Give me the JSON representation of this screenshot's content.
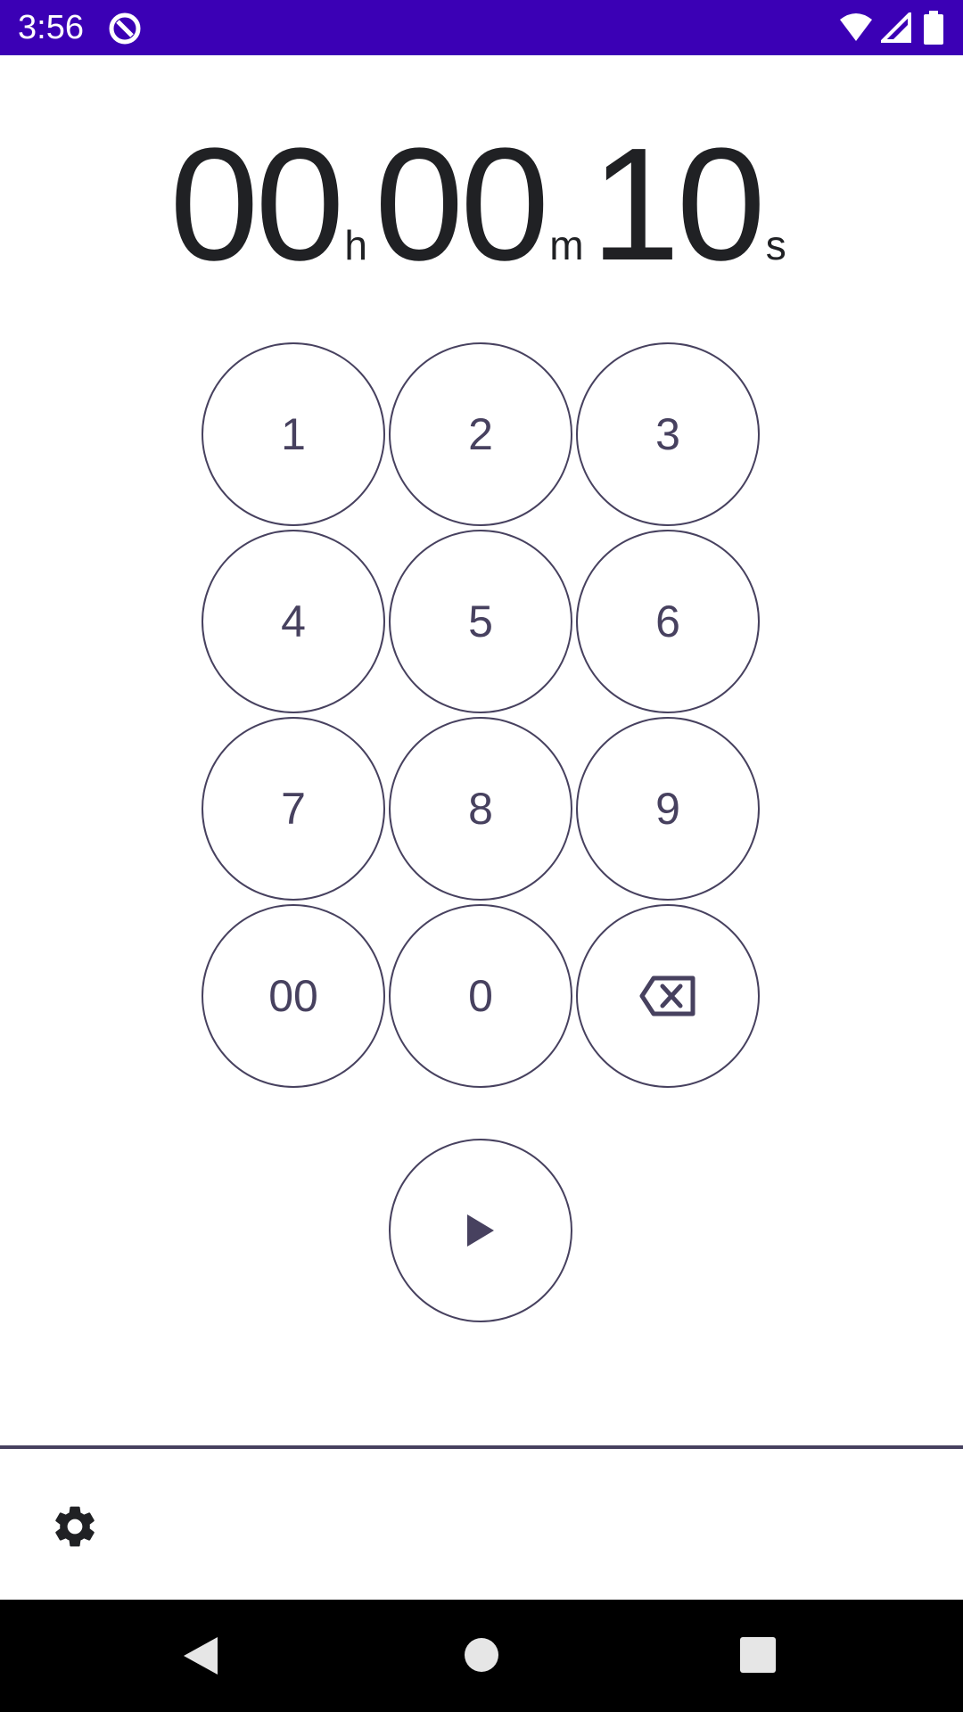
{
  "status_bar": {
    "time": "3:56",
    "icons": [
      "data-saver-icon",
      "wifi-icon",
      "signal-icon",
      "battery-icon"
    ]
  },
  "timer": {
    "hours": "00",
    "hours_unit": "h",
    "minutes": "00",
    "minutes_unit": "m",
    "seconds": "10",
    "seconds_unit": "s"
  },
  "keypad": {
    "keys": [
      "1",
      "2",
      "3",
      "4",
      "5",
      "6",
      "7",
      "8",
      "9",
      "00",
      "0"
    ],
    "backspace_icon": "backspace-icon"
  },
  "actions": {
    "start_icon": "play-icon",
    "settings_icon": "gear-icon"
  },
  "nav_bar": {
    "icons": [
      "back-icon",
      "home-icon",
      "recents-icon"
    ]
  },
  "colors": {
    "status_bar": "#3b00b5",
    "accent": "#47415f",
    "text": "#202124",
    "nav_bar": "#000000"
  }
}
